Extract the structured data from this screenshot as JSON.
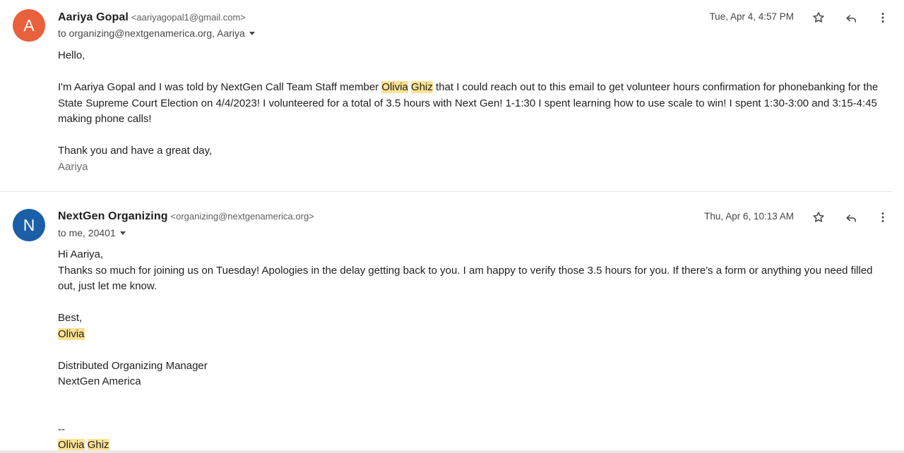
{
  "messages": [
    {
      "avatar_letter": "A",
      "avatar_color": "#e8603c",
      "sender_name": "Aariya Gopal",
      "sender_email": "<aariyagopal1@gmail.com>",
      "recipients": "to organizing@nextgenamerica.org, Aariya",
      "date": "Tue, Apr 4, 4:57 PM",
      "body": {
        "greeting": "Hello,",
        "p1_part1": "I'm Aariya Gopal and I was told by NextGen Call Team Staff member ",
        "p1_hl1": "Olivia",
        "p1_hl2": "Ghiz",
        "p1_part2": " that I could reach out to this email to get volunteer hours confirmation for phonebanking for the State Supreme Court Election on 4/4/2023! I volunteered for a total of 3.5 hours with Next Gen! 1-1:30 I spent learning how to use scale to win! I spent 1:30-3:00 and 3:15-4:45 making phone calls!",
        "closing": "Thank you and have a great day,",
        "signature": "Aariya"
      }
    },
    {
      "avatar_letter": "N",
      "avatar_color": "#1a5fa8",
      "sender_name": "NextGen Organizing",
      "sender_email": "<organizing@nextgenamerica.org>",
      "recipients": "to me, 20401",
      "date": "Thu, Apr 6, 10:13 AM",
      "body": {
        "greeting": "Hi Aariya,",
        "p1": "Thanks so much for joining us on Tuesday! Apologies in the delay getting back to you. I am happy to verify those 3.5 hours for you. If there's a form or anything you need filled out, just let me know.",
        "closing": "Best,",
        "sign_name": "Olivia",
        "title_line": "Distributed Organizing Manager",
        "org_line": "NextGen America",
        "sig_dash": "--",
        "sig_first": "Olivia",
        "sig_last": "Ghiz"
      }
    }
  ],
  "icons": {
    "star": "star-icon",
    "reply": "reply-icon",
    "more": "more-vert-icon"
  },
  "colors": {
    "highlight": "#fde293"
  }
}
